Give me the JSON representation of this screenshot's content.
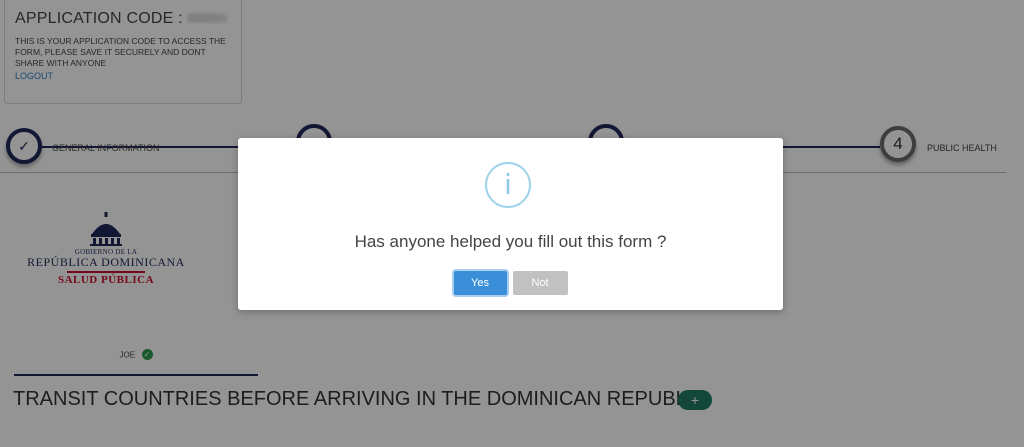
{
  "app_card": {
    "title": "APPLICATION CODE :",
    "description": "THIS IS YOUR APPLICATION CODE TO ACCESS THE FORM, PLEASE SAVE IT SECURELY AND DONT SHARE WITH ANYONE",
    "logout": "LOGOUT"
  },
  "stepper": {
    "steps": [
      {
        "label": "GENERAL INFORMATION",
        "status": "done"
      },
      {
        "label": "",
        "status": "done"
      },
      {
        "label": "",
        "status": "done"
      },
      {
        "label": "PUBLIC HEALTH",
        "number": "4",
        "status": "current"
      }
    ],
    "check_glyph": "✓"
  },
  "logo": {
    "line1": "GOBIERNO DE LA",
    "line2": "REPÚBLICA DOMINICANA",
    "line3": "SALUD PÚBLICA"
  },
  "traveler_tab": {
    "name": "JOE",
    "check_glyph": "✓"
  },
  "transit": {
    "heading": "TRANSIT COUNTRIES BEFORE ARRIVING IN THE DOMINICAN REPUBLIC",
    "add_glyph": "+"
  },
  "modal": {
    "icon_glyph": "i",
    "question": "Has anyone helped you fill out this form ?",
    "yes_label": "Yes",
    "no_label": "Not"
  },
  "colors": {
    "navy": "#1f2a5a",
    "primary_button": "#3b8fd8",
    "secondary_button": "#c1c1c1",
    "add_button": "#1f7a63",
    "brand_red": "#c8102e",
    "success_green": "#2e9a4e",
    "info_blue": "#8ccbe6"
  }
}
